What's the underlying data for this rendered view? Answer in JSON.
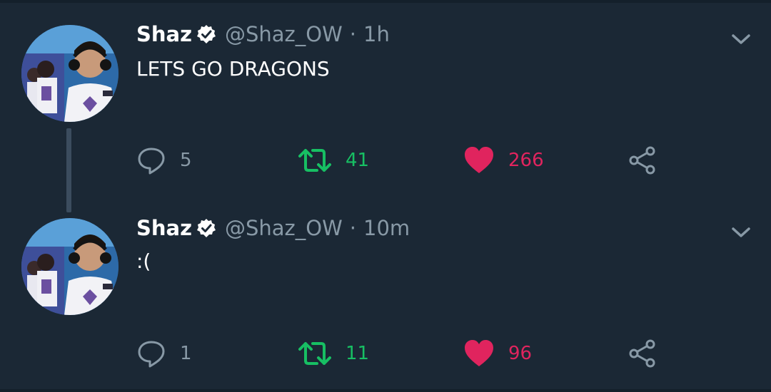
{
  "tweets": [
    {
      "name": "Shaz",
      "handle": "@Shaz_OW",
      "separator": "·",
      "time": "1h",
      "text": "LETS GO DRAGONS",
      "replies": "5",
      "retweets": "41",
      "likes": "266"
    },
    {
      "name": "Shaz",
      "handle": "@Shaz_OW",
      "separator": "·",
      "time": "10m",
      "text": ":(",
      "replies": "1",
      "retweets": "11",
      "likes": "96"
    }
  ],
  "colors": {
    "background": "#1b2835",
    "secondary_text": "#8899a6",
    "retweet_green": "#17bf63",
    "like_red": "#e0245e",
    "thread_line": "#3b4c5e"
  },
  "icons": {
    "verified": "verified-badge-icon",
    "more": "chevron-down-icon",
    "reply": "reply-icon",
    "retweet": "retweet-icon",
    "like": "heart-icon",
    "share": "share-icon"
  }
}
